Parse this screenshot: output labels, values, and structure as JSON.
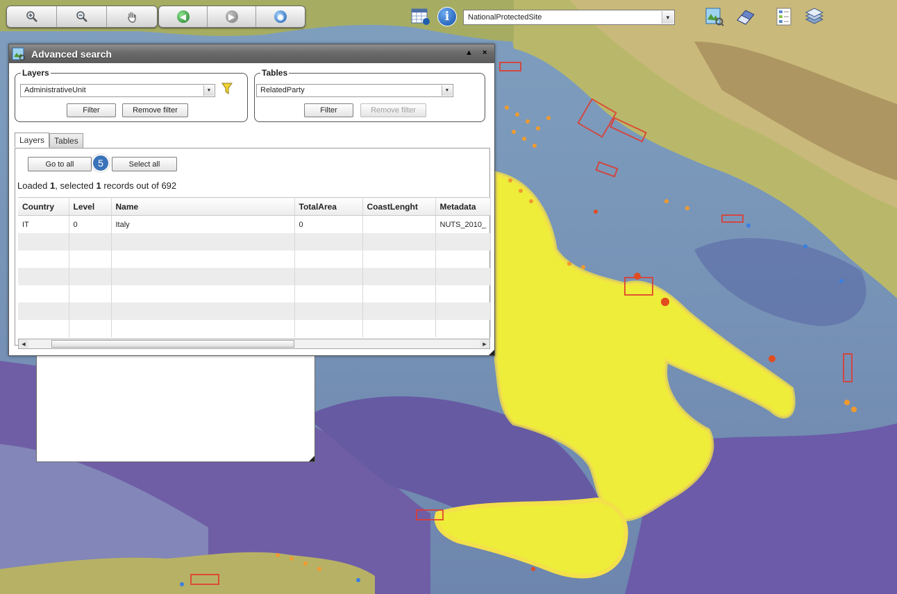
{
  "toolbar": {
    "buttons": [
      {
        "icon": "zoom-in-icon"
      },
      {
        "icon": "zoom-out-icon"
      },
      {
        "icon": "pan-hand-icon"
      },
      {
        "icon": "previous-extent-icon"
      },
      {
        "icon": "next-extent-icon"
      },
      {
        "icon": "full-extent-icon"
      }
    ],
    "layer_select_value": "NationalProtectedSite",
    "right_icons": [
      "attribute-table-icon",
      "identify-info-icon",
      "advanced-search-icon",
      "eraser-icon",
      "legend-icon",
      "layers-icon"
    ]
  },
  "window": {
    "title": "Advanced search",
    "layers_group": {
      "legend": "Layers",
      "selected": "AdministrativeUnit",
      "filter_label": "Filter",
      "remove_filter_label": "Remove filter"
    },
    "tables_group": {
      "legend": "Tables",
      "selected": "RelatedParty",
      "filter_label": "Filter",
      "remove_filter_label": "Remove filter"
    },
    "tabs": [
      {
        "label": "Layers",
        "active": true
      },
      {
        "label": "Tables",
        "active": false
      }
    ],
    "go_to_all_label": "Go to all",
    "select_all_label": "Select all",
    "step_badge": "5",
    "status": {
      "prefix": "Loaded ",
      "loaded": "1",
      "middle": ", selected ",
      "selected": "1",
      "suffix": " records out of 692"
    },
    "table": {
      "columns": [
        "Country",
        "Level",
        "Name",
        "TotalArea",
        "CoastLenght",
        "Metadata"
      ],
      "rows": [
        [
          "IT",
          "0",
          "Italy",
          "0",
          "",
          "NUTS_2010_"
        ]
      ]
    }
  }
}
